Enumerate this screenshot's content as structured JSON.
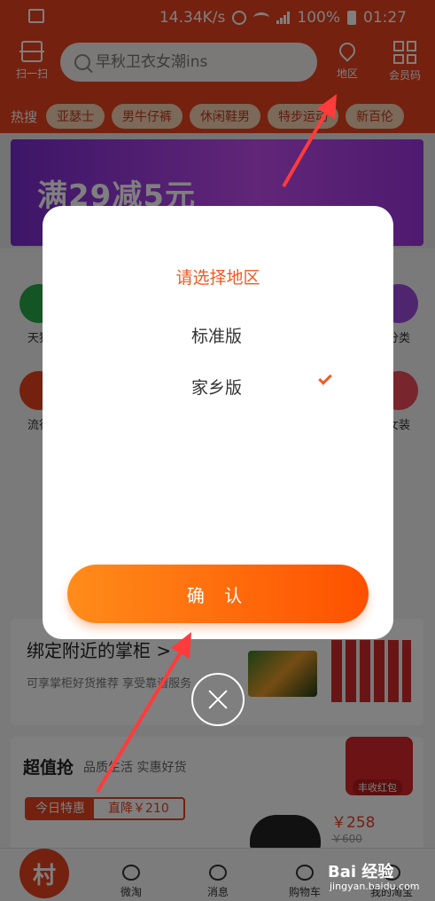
{
  "status": {
    "speed": "14.34K/s",
    "battery": "100%",
    "time": "01:27"
  },
  "header": {
    "scan_label": "扫一扫",
    "search_placeholder": "早秋卫衣女潮ins",
    "area_label": "地区",
    "member_label": "会员码",
    "hot_label": "热搜",
    "hot_tags": [
      "亚瑟士",
      "男牛仔裤",
      "休闲鞋男",
      "特步运动",
      "新百伦"
    ]
  },
  "banner": {
    "text": "满29减5元"
  },
  "categories": [
    {
      "label": "天猫",
      "color": "#29a84a"
    },
    {
      "label": "分类",
      "color": "#a04adf"
    },
    {
      "label": "流行",
      "color": "#e8421f"
    },
    {
      "label": "女装",
      "color": "#f04a5c"
    }
  ],
  "promo": {
    "title": "绑定附近的掌柜 >",
    "subtitle": "可享掌柜好货推荐 享受靠谱服务"
  },
  "deals": {
    "title": "超值抢",
    "subtitle": "品质生活 实惠好货",
    "redpacket_label": "丰收红包",
    "today_label": "今日特惠",
    "discount_label": "直降￥210",
    "price": "￥258",
    "old_price": "￥600"
  },
  "tabbar": {
    "village": "村",
    "items": [
      "微淘",
      "消息",
      "购物车",
      "我的淘宝"
    ]
  },
  "modal": {
    "title": "请选择地区",
    "options": [
      {
        "label": "标准版",
        "selected": false
      },
      {
        "label": "家乡版",
        "selected": true
      }
    ],
    "confirm_label": "确 认"
  },
  "watermark": {
    "brand": "Bai 经验",
    "url": "jingyan.baidu.com"
  },
  "colors": {
    "brand": "#e8421f",
    "accent": "#f05a22",
    "button_start": "#ff8c1a",
    "button_end": "#ff5000"
  }
}
